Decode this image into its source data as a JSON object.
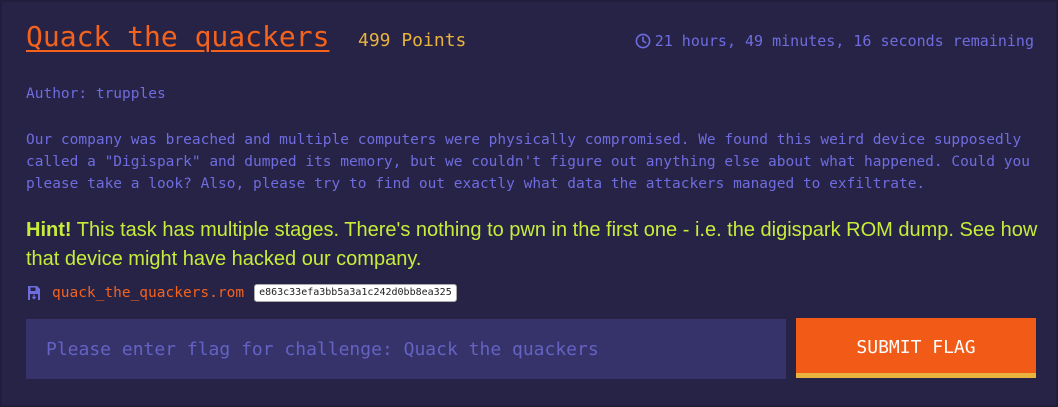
{
  "challenge": {
    "title": "Quack the quackers",
    "points": "499 Points",
    "time_remaining": "21 hours, 49 minutes, 16 seconds remaining",
    "author": "Author: trupples",
    "description": "Our company was breached and multiple computers were physically compromised. We found this weird device supposedly called a \"Digispark\" and dumped its memory, but we couldn't figure out anything else about what happened. Could you please take a look? Also, please try to find out exactly what data the attackers managed to exfiltrate.",
    "hint_label": "Hint!",
    "hint_text": " This task has multiple stages. There's nothing to pwn in the first one - i.e. the digispark ROM dump. See how that device might have hacked our company."
  },
  "attachment": {
    "icon": "file-download-icon",
    "filename": "quack_the_quackers.rom",
    "hash": "e863c33efa3bb5a3a1c242d0bb8ea325"
  },
  "flag_form": {
    "placeholder": "Please enter flag for challenge: Quack the quackers",
    "value": "",
    "submit_label": "SUBMIT FLAG"
  },
  "colors": {
    "background": "#211e3d",
    "card": "#262346",
    "accent_orange": "#f5621c",
    "points_yellow": "#e9b33d",
    "muted_purple": "#6f6ce0",
    "hint_green": "#c7ec3a",
    "input_bg": "#36336a"
  }
}
